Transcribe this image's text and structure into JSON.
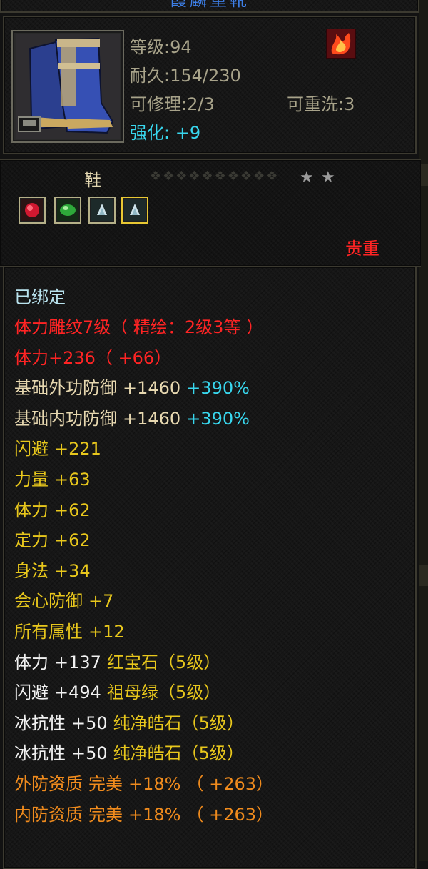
{
  "item": {
    "title": "霞麟重靴",
    "level": "等级:94",
    "durability": "耐久:154/230",
    "repairable": "可修理:2/3",
    "rewashable": "可重洗:3",
    "enhance_label": "强化:",
    "enhance_value": "+9",
    "slot_type": "鞋",
    "grade": "贵重",
    "bound": "已绑定"
  },
  "stats": [
    {
      "parts": [
        {
          "text": "体力雕纹7级（ 精绘：2级3等 ）",
          "color": "red"
        }
      ]
    },
    {
      "parts": [
        {
          "text": "体力+236（ +66）",
          "color": "red"
        }
      ]
    },
    {
      "parts": [
        {
          "text": "基础外功防御",
          "color": "beige"
        },
        {
          "text": "+1460",
          "color": "beige"
        },
        {
          "text": "+390%",
          "color": "cyan"
        }
      ]
    },
    {
      "parts": [
        {
          "text": "基础内功防御",
          "color": "beige"
        },
        {
          "text": "+1460",
          "color": "beige"
        },
        {
          "text": "+390%",
          "color": "cyan"
        }
      ]
    },
    {
      "parts": [
        {
          "text": "闪避",
          "color": "yellow"
        },
        {
          "text": "+221",
          "color": "yellow"
        }
      ]
    },
    {
      "parts": [
        {
          "text": "力量",
          "color": "yellow"
        },
        {
          "text": "+63",
          "color": "yellow"
        }
      ]
    },
    {
      "parts": [
        {
          "text": "体力",
          "color": "yellow"
        },
        {
          "text": "+62",
          "color": "yellow"
        }
      ]
    },
    {
      "parts": [
        {
          "text": "定力",
          "color": "yellow"
        },
        {
          "text": "+62",
          "color": "yellow"
        }
      ]
    },
    {
      "parts": [
        {
          "text": "身法",
          "color": "yellow"
        },
        {
          "text": "+34",
          "color": "yellow"
        }
      ]
    },
    {
      "parts": [
        {
          "text": "会心防御",
          "color": "yellow"
        },
        {
          "text": "+7",
          "color": "yellow"
        }
      ]
    },
    {
      "parts": [
        {
          "text": "所有属性",
          "color": "yellow"
        },
        {
          "text": "+12",
          "color": "yellow"
        }
      ]
    },
    {
      "parts": [
        {
          "text": "体力",
          "color": "white"
        },
        {
          "text": "+137",
          "color": "white"
        },
        {
          "text": "红宝石（5级）",
          "color": "yellow"
        }
      ]
    },
    {
      "parts": [
        {
          "text": "闪避",
          "color": "white"
        },
        {
          "text": "+494",
          "color": "white"
        },
        {
          "text": "祖母绿（5级）",
          "color": "yellow"
        }
      ]
    },
    {
      "parts": [
        {
          "text": "冰抗性",
          "color": "white"
        },
        {
          "text": "+50",
          "color": "white"
        },
        {
          "text": "纯净皓石（5级）",
          "color": "yellow"
        }
      ]
    },
    {
      "parts": [
        {
          "text": "冰抗性",
          "color": "white"
        },
        {
          "text": "+50",
          "color": "white"
        },
        {
          "text": "纯净皓石（5级）",
          "color": "yellow"
        }
      ]
    },
    {
      "parts": [
        {
          "text": "外防资质",
          "color": "orange"
        },
        {
          "text": "完美",
          "color": "orange"
        },
        {
          "text": "+18%",
          "color": "orange"
        },
        {
          "text": "（ +263）",
          "color": "orange"
        }
      ]
    },
    {
      "parts": [
        {
          "text": "内防资质",
          "color": "orange"
        },
        {
          "text": "完美",
          "color": "orange"
        },
        {
          "text": "+18%",
          "color": "orange"
        },
        {
          "text": "（ +263）",
          "color": "orange"
        }
      ]
    }
  ],
  "gems": [
    {
      "icon": "ruby-gem-icon"
    },
    {
      "icon": "emerald-gem-icon"
    },
    {
      "icon": "diamond-gem-icon"
    },
    {
      "icon": "diamond-gem-icon"
    }
  ],
  "stars": {
    "filled": 2
  },
  "colors": {
    "red": "#ff2424",
    "yellow": "#e8c71c",
    "orange": "#f08b1d",
    "cyan": "#38d7ee",
    "beige": "#e7d8b0",
    "white": "#f1f1f1",
    "title_blue": "#3d7fe8"
  }
}
